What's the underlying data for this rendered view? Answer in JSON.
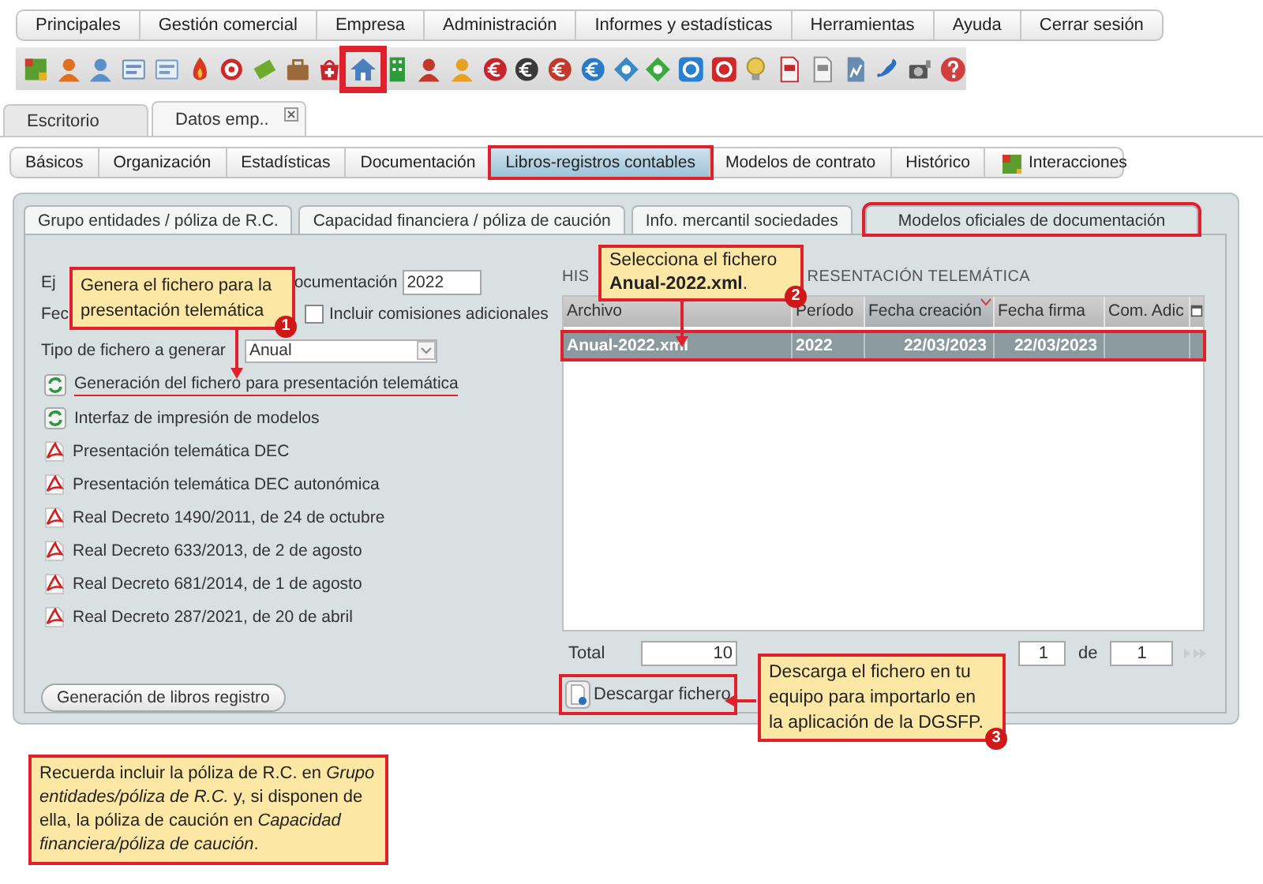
{
  "menu": [
    "Principales",
    "Gestión comercial",
    "Empresa",
    "Administración",
    "Informes y estadísticas",
    "Herramientas",
    "Ayuda",
    "Cerrar sesión"
  ],
  "toolbar": [
    {
      "kind": "cube",
      "color": "#5a9e2f",
      "highlighted": false
    },
    {
      "kind": "person",
      "color": "#e07020",
      "highlighted": false
    },
    {
      "kind": "person",
      "color": "#5b8fc9",
      "highlighted": false
    },
    {
      "kind": "card",
      "color": "#6d8fb5",
      "highlighted": false
    },
    {
      "kind": "card",
      "color": "#7a9cc0",
      "highlighted": false
    },
    {
      "kind": "flame",
      "color": "#d9381e",
      "highlighted": false
    },
    {
      "kind": "target",
      "color": "#cc2a2a",
      "highlighted": false
    },
    {
      "kind": "notes",
      "color": "#6cab2c",
      "highlighted": false
    },
    {
      "kind": "briefcase",
      "color": "#9a6a3a",
      "highlighted": false
    },
    {
      "kind": "bag",
      "color": "#c8242b",
      "highlighted": false
    },
    {
      "kind": "house",
      "color": "#4a7fc0",
      "highlighted": true
    },
    {
      "kind": "building",
      "color": "#2f9a3a",
      "highlighted": false
    },
    {
      "kind": "person",
      "color": "#c0392b",
      "highlighted": false
    },
    {
      "kind": "person",
      "color": "#e8a020",
      "highlighted": false
    },
    {
      "kind": "coin",
      "color": "#c8242b",
      "highlighted": false
    },
    {
      "kind": "coin",
      "color": "#3a3a3a",
      "highlighted": false
    },
    {
      "kind": "coin",
      "color": "#c0392b",
      "highlighted": false
    },
    {
      "kind": "coin",
      "color": "#2a7ac8",
      "highlighted": false
    },
    {
      "kind": "diamond",
      "color": "#3a8ac8",
      "highlighted": false
    },
    {
      "kind": "diamond",
      "color": "#3aaa3a",
      "highlighted": false
    },
    {
      "kind": "square",
      "color": "#2a80d0",
      "highlighted": false
    },
    {
      "kind": "square",
      "color": "#d02828",
      "highlighted": false
    },
    {
      "kind": "bulb",
      "color": "#e8c850",
      "highlighted": false
    },
    {
      "kind": "document",
      "color": "#c8242b",
      "highlighted": false
    },
    {
      "kind": "document",
      "color": "#8a8a8a",
      "highlighted": false
    },
    {
      "kind": "chart",
      "color": "#6a8ab0",
      "highlighted": false
    },
    {
      "kind": "phone",
      "color": "#2a70c0",
      "highlighted": false
    },
    {
      "kind": "projector",
      "color": "#555555",
      "highlighted": false
    },
    {
      "kind": "question",
      "color": "#d04040",
      "highlighted": false
    }
  ],
  "doc_tabs": [
    {
      "label": "Escritorio",
      "selected": false,
      "closable": false
    },
    {
      "label": "Datos emp..",
      "selected": true,
      "closable": true
    }
  ],
  "section_tabs": [
    {
      "label": "Básicos",
      "selected": false,
      "highlighted": false,
      "has_icon": false
    },
    {
      "label": "Organización",
      "selected": false,
      "highlighted": false,
      "has_icon": false
    },
    {
      "label": "Estadísticas",
      "selected": false,
      "highlighted": false,
      "has_icon": false
    },
    {
      "label": "Documentación",
      "selected": false,
      "highlighted": false,
      "has_icon": false
    },
    {
      "label": "Libros-registros contables",
      "selected": true,
      "highlighted": true,
      "has_icon": false
    },
    {
      "label": "Modelos de contrato",
      "selected": false,
      "highlighted": false,
      "has_icon": false
    },
    {
      "label": "Histórico",
      "selected": false,
      "highlighted": false,
      "has_icon": false
    },
    {
      "label": "Interacciones",
      "selected": false,
      "highlighted": false,
      "has_icon": true
    }
  ],
  "form_tabs": [
    {
      "label": "Grupo entidades / póliza de R.C.",
      "selected": false,
      "highlighted": false
    },
    {
      "label": "Capacidad financiera / póliza de caución",
      "selected": false,
      "highlighted": false
    },
    {
      "label": "Info. mercantil sociedades",
      "selected": false,
      "highlighted": false
    },
    {
      "label": "Modelos oficiales de documentación",
      "selected": true,
      "highlighted": true
    }
  ],
  "form": {
    "year": {
      "label_start": "Ej",
      "label_end": "ocumentación",
      "value": "2022"
    },
    "date": {
      "label_start": "Fec",
      "checkbox_label": "Incluir comisiones adicionales",
      "checked": false
    },
    "file_type": {
      "label": "Tipo de fichero a generar",
      "value": "Anual"
    }
  },
  "actions": [
    {
      "kind": "refresh",
      "label": "Generación del fichero para presentación telemática",
      "underlined": true
    },
    {
      "kind": "refresh",
      "label": "Interfaz de impresión de modelos",
      "underlined": false
    },
    {
      "kind": "pdf",
      "label": "Presentación telemática DEC",
      "underlined": false
    },
    {
      "kind": "pdf",
      "label": "Presentación telemática DEC autonómica",
      "underlined": false
    },
    {
      "kind": "pdf",
      "label": "Real Decreto 1490/2011, de 24 de octubre",
      "underlined": false
    },
    {
      "kind": "pdf",
      "label": "Real Decreto 633/2013, de 2 de agosto",
      "underlined": false
    },
    {
      "kind": "pdf",
      "label": "Real Decreto 681/2014, de 1 de agosto",
      "underlined": false
    },
    {
      "kind": "pdf",
      "label": "Real Decreto 287/2021, de 20 de abril",
      "underlined": false
    }
  ],
  "generate_button": "Generación de libros registro",
  "history": {
    "title_start": "HIS",
    "title_end": "RESENTACIÓN TELEMÁTICA",
    "columns": [
      {
        "label": "Archivo",
        "sorted": false
      },
      {
        "label": "Período",
        "sorted": false
      },
      {
        "label": "Fecha creación",
        "sorted": true
      },
      {
        "label": "Fecha firma",
        "sorted": false
      },
      {
        "label": "Com. Adic",
        "sorted": false
      }
    ],
    "rows": [
      {
        "cells": [
          "Anual-2022.xml",
          "2022",
          "22/03/2023",
          "22/03/2023"
        ],
        "selected": true,
        "highlighted": true
      }
    ],
    "total_label": "Total",
    "total": "10",
    "page": "1",
    "page_of": "de",
    "pages": "1",
    "download_button": {
      "label": "Descargar fichero",
      "highlighted": true
    }
  },
  "callouts": [
    {
      "text": "Genera el fichero para la presentación telemática",
      "number": "1"
    },
    {
      "text": "Selecciona el fichero **Anual-2022.xml**.",
      "number": "2"
    },
    {
      "text": "Descarga el fichero en tu equipo para importarlo en la aplicación de la DGSFP.",
      "number": "3"
    }
  ],
  "note": "Recuerda incluir la póliza de R.C. en *Grupo entidades/póliza de R.C.* y, si disponen de ella, la póliza de caución en *Capacidad financiera/póliza de caución*."
}
